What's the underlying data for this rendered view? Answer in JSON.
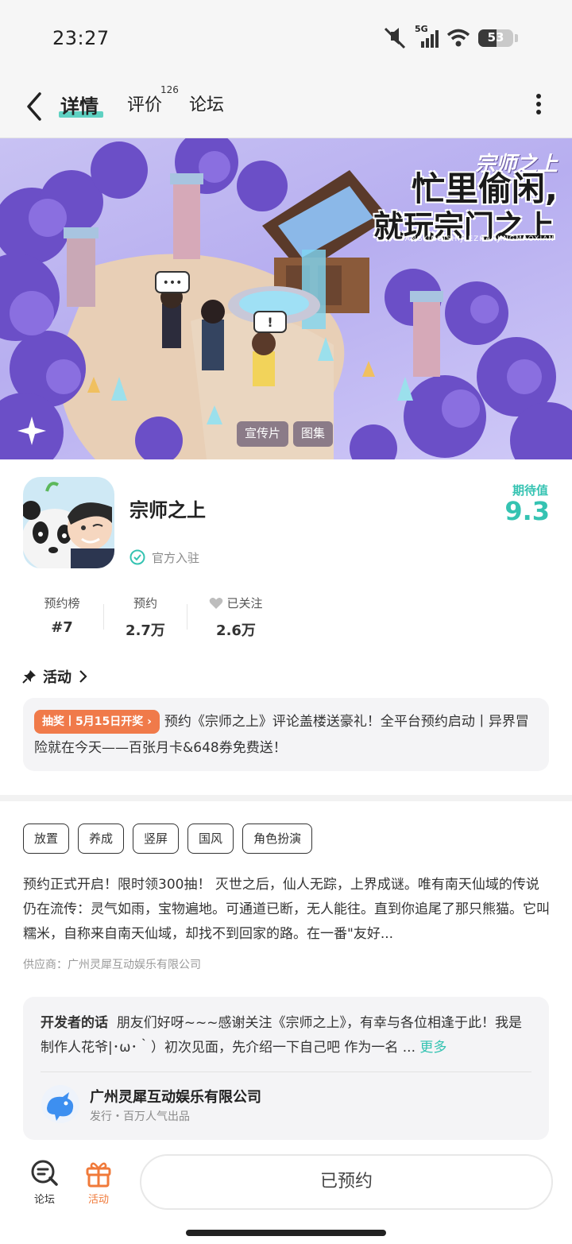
{
  "status_bar": {
    "time": "23:27",
    "network": "5G",
    "battery": "53"
  },
  "header": {
    "tabs": [
      {
        "label": "详情",
        "active": true
      },
      {
        "label": "评价",
        "count": "126"
      },
      {
        "label": "论坛"
      }
    ]
  },
  "banner": {
    "slogan_line1": "忙里偷闲,",
    "slogan_line2": "就玩宗门之上",
    "slogan_sub": "TANGYINGISHIJLEZHANJINGMAOXIAN",
    "logo_text": "宗师之上",
    "buttons": [
      "宣传片",
      "图集"
    ]
  },
  "game": {
    "title": "宗师之上",
    "official_label": "官方入驻",
    "rating_label": "期待值",
    "rating_value": "9.3"
  },
  "stats": [
    {
      "label": "预约榜",
      "value": "#7"
    },
    {
      "label": "预约",
      "value": "2.7万"
    },
    {
      "label": "已关注",
      "value": "2.6万"
    }
  ],
  "activity": {
    "heading": "活动",
    "badge": "抽奖丨5月15日开奖",
    "text": "预约《宗师之上》评论盖楼送豪礼！全平台预约启动丨异界冒险就在今天——百张月卡&648券免费送！"
  },
  "tags": [
    "放置",
    "养成",
    "竖屏",
    "国风",
    "角色扮演"
  ],
  "description": "预约正式开启！限时领300抽！ 灭世之后，仙人无踪，上界成谜。唯有南天仙域的传说仍在流传：灵气如雨，宝物遍地。可通道已断，无人能往。直到你追尾了那只熊猫。它叫糯米，自称来自南天仙域，却找不到回家的路。在一番\"友好...",
  "supplier": "供应商：广州灵犀互动娱乐有限公司",
  "developer": {
    "label": "开发者的话",
    "text": "朋友们好呀~~~感谢关注《宗师之上》，有幸与各位相逢于此！我是制作人花爷|･ω･｀）初次见面，先介绍一下自己吧 作为一名 ...",
    "more": "更多",
    "company": "广州灵犀互动娱乐有限公司",
    "sub": "发行・百万人气出品"
  },
  "bottom_nav": {
    "forum": "论坛",
    "activity": "活动",
    "reserve_button": "已预约"
  },
  "colors": {
    "accent": "#35c3b2",
    "orange": "#f07a4a",
    "banner_bg": "#b7aef0"
  }
}
